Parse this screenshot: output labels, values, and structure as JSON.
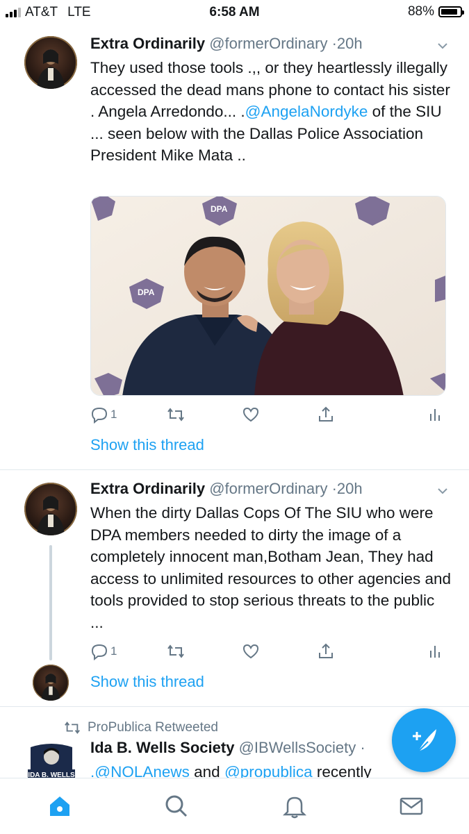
{
  "status": {
    "carrier": "AT&T",
    "network": "LTE",
    "time": "6:58 AM",
    "battery": "88%",
    "battery_level": 0.88
  },
  "tweets": [
    {
      "name": "Extra Ordinarily",
      "handle": "@formerOrdinary",
      "time": "20h",
      "text_1": "They used those tools .,, or they heartlessly illegally accessed the dead mans phone  to contact his sister .  Angela Arredondo... .",
      "mention": "@AngelaNordyke",
      "text_2": " of the SIU ... seen below with the Dallas Police Association President Mike Mata ..",
      "reply_count": "1",
      "show_thread": "Show this thread"
    },
    {
      "name": "Extra Ordinarily",
      "handle": "@formerOrdinary",
      "time": "20h",
      "text": "When the dirty Dallas Cops Of The SIU who were DPA members needed to dirty the image of a completely innocent man,Botham Jean, They had access to unlimited resources to other agencies and tools provided to stop serious threats to the public ...",
      "reply_count": "1",
      "show_thread": "Show this thread"
    }
  ],
  "retweet": {
    "label": "ProPublica Retweeted",
    "name": "Ida B. Wells Society",
    "handle": "@IBWellsSociety",
    "mention_1": ".@NOLAnews",
    "connector": " and ",
    "mention_2": "@propublica",
    "text_tail": " recently"
  },
  "colors": {
    "accent": "#1da1f2",
    "secondary_text": "#657786"
  },
  "icons": [
    "reply-icon",
    "retweet-icon",
    "like-icon",
    "share-icon",
    "analytics-icon",
    "compose-icon",
    "home-icon",
    "search-icon",
    "notifications-icon",
    "messages-icon"
  ]
}
